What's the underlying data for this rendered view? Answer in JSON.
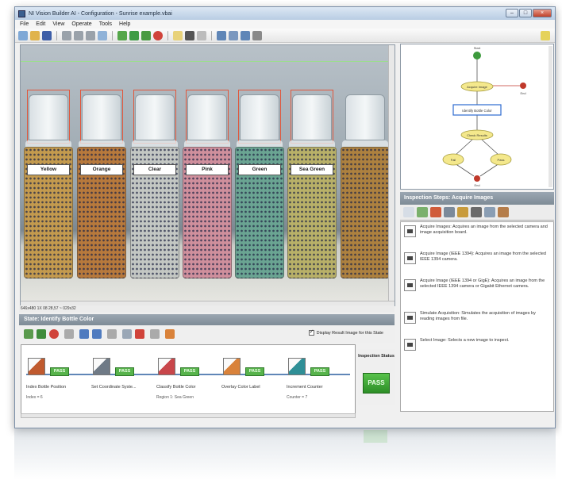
{
  "window": {
    "title": "NI Vision Builder AI - Configuration - Sunrise example.vbai",
    "controls": [
      "–",
      "□",
      "×"
    ]
  },
  "menu": [
    "File",
    "Edit",
    "View",
    "Operate",
    "Tools",
    "Help"
  ],
  "bottles": [
    {
      "label": "Yellow",
      "fill": "#c39a4e"
    },
    {
      "label": "Orange",
      "fill": "#b7793c"
    },
    {
      "label": "Clear",
      "fill": "#c3c7c3"
    },
    {
      "label": "Pink",
      "fill": "#cf8f9c"
    },
    {
      "label": "Green",
      "fill": "#6aa492"
    },
    {
      "label": "Sea Green",
      "fill": "#b8b068"
    },
    {
      "label": "",
      "fill": "#ad813f"
    }
  ],
  "image_status": "646x480 1X 08 28,57 ~ 029x32",
  "state_panel": {
    "title": "State: Identify Bottle Color",
    "checkbox_label": "Display Result Image for this State"
  },
  "steps": [
    {
      "name": "Index Bottle Position",
      "detail": "Index = 6",
      "status": "PASS"
    },
    {
      "name": "Set Coordinate Syste...",
      "detail": "",
      "status": "PASS"
    },
    {
      "name": "Classify Bottle Color",
      "detail": "Region 1: Sea Green",
      "status": "PASS"
    },
    {
      "name": "Overlay Color Label",
      "detail": "",
      "status": "PASS"
    },
    {
      "name": "Increment Counter",
      "detail": "Counter = 7",
      "status": "PASS"
    }
  ],
  "inspection_status": {
    "label": "Inspection Status",
    "value": "PASS"
  },
  "flow": {
    "nodes": [
      "Start",
      "Acquire Image",
      "Identify Bottle Color",
      "Check Results",
      "Fail",
      "Pass",
      "End",
      "End"
    ]
  },
  "inspection_steps": {
    "title": "Inspection Steps: Acquire Images",
    "items": [
      "Acquire Images: Acquires an image from the selected camera and image acquisition board.",
      "Acquire Image (IEEE 1394): Acquires an image from the selected IEEE 1394 camera.",
      "Acquire Image (IEEE 1394 or GigE): Acquires an image from the selected IEEE 1394 camera or Gigabit Ethernet camera.",
      "Simulate Acquisition: Simulates the acquisition of images by reading images from file.",
      "Select Image: Selects a new image to inspect."
    ]
  },
  "colors": {
    "accent": "#5f86b7",
    "pass": "#57b34b",
    "roi": "#e0573c",
    "panel_head": "#8c98a4"
  }
}
